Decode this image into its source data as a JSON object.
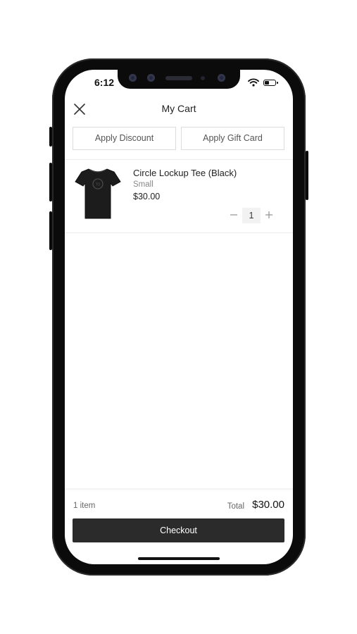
{
  "status_bar": {
    "time": "6:12",
    "icons": [
      "wifi-icon",
      "battery-icon"
    ]
  },
  "header": {
    "title": "My Cart",
    "close_icon": "close-icon"
  },
  "actions": {
    "discount_label": "Apply Discount",
    "gift_card_label": "Apply Gift Card"
  },
  "cart": {
    "items": [
      {
        "name": "Circle Lockup Tee (Black)",
        "variant": "Small",
        "price": "$30.00",
        "quantity": "1",
        "image_icon": "tshirt-icon"
      }
    ]
  },
  "summary": {
    "item_count": "1 item",
    "total_label": "Total",
    "total_value": "$30.00"
  },
  "checkout": {
    "label": "Checkout"
  },
  "colors": {
    "checkout_bg": "#2b2b2b",
    "phone_frame": "#0b0b0b",
    "border": "#dcdcdc"
  }
}
